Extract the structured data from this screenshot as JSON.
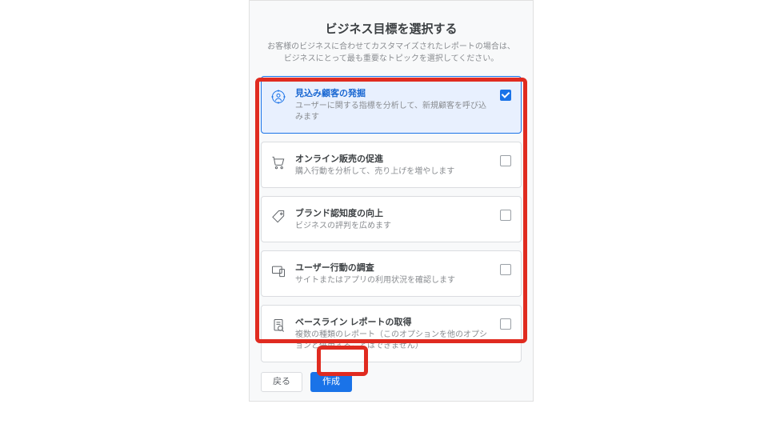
{
  "header": {
    "title": "ビジネス目標を選択する",
    "subtitle_line1": "お客様のビジネスに合わせてカスタマイズされたレポートの場合は、",
    "subtitle_line2": "ビジネスにとって最も重要なトピックを選択してください。"
  },
  "options": [
    {
      "id": "lead-gen",
      "icon": "target-user",
      "label": "見込み顧客の発掘",
      "desc": "ユーザーに関する指標を分析して、新規顧客を呼び込みます",
      "checked": true
    },
    {
      "id": "online-sales",
      "icon": "cart",
      "label": "オンライン販売の促進",
      "desc": "購入行動を分析して、売り上げを増やします",
      "checked": false
    },
    {
      "id": "brand-awareness",
      "icon": "tag",
      "label": "ブランド認知度の向上",
      "desc": "ビジネスの評判を広めます",
      "checked": false
    },
    {
      "id": "user-behavior",
      "icon": "devices",
      "label": "ユーザー行動の調査",
      "desc": "サイトまたはアプリの利用状況を確認します",
      "checked": false
    },
    {
      "id": "baseline",
      "icon": "report",
      "label": "ベースライン レポートの取得",
      "desc": "複数の種類のレポート（このオプションを他のオプションと併用することはできません）",
      "checked": false
    }
  ],
  "footer": {
    "back_label": "戻る",
    "create_label": "作成"
  },
  "colors": {
    "accent": "#1a73e8",
    "highlight": "#e02b20"
  }
}
